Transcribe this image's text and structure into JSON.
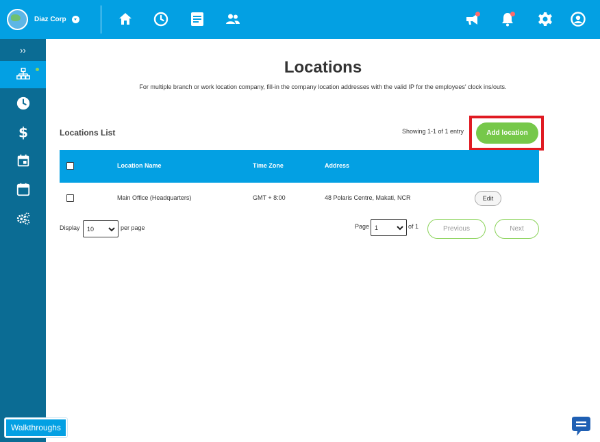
{
  "header": {
    "company_name": "Diaz Corp",
    "nav_icons": [
      "home-icon",
      "clock-icon",
      "document-icon",
      "people-icon"
    ],
    "right_icons": [
      "megaphone-icon",
      "bell-icon",
      "gear-icon",
      "user-icon"
    ]
  },
  "sidebar": {
    "expand_label": "››",
    "items": [
      "org-chart-icon",
      "clock-icon",
      "dollar-icon",
      "calendar-icon",
      "calendar-alt-icon",
      "gears-icon"
    ],
    "active_index": 0
  },
  "page": {
    "title": "Locations",
    "subtitle": "For multiple branch or work location company, fill-in the company location addresses with the valid IP for the employees' clock ins/outs."
  },
  "list": {
    "title": "Locations List",
    "showing": "Showing 1-1 of 1 entry",
    "add_button": "Add location",
    "columns": [
      "Location Name",
      "Time Zone",
      "Address"
    ],
    "rows": [
      {
        "name": "Main Office (Headquarters)",
        "timezone": "GMT + 8:00",
        "address": "48 Polaris Centre, Makati, NCR",
        "action": "Edit"
      }
    ]
  },
  "pagination": {
    "display_label": "Display",
    "per_page_value": "10",
    "per_page_label": "per page",
    "page_label": "Page",
    "page_value": "1",
    "of_label": "of 1",
    "previous": "Previous",
    "next": "Next"
  },
  "footer": {
    "walkthroughs": "Walkthroughs"
  },
  "colors": {
    "primary": "#03a0e3",
    "sidebar": "#0b6c94",
    "add_button": "#76c84a",
    "highlight": "#e01a22"
  }
}
